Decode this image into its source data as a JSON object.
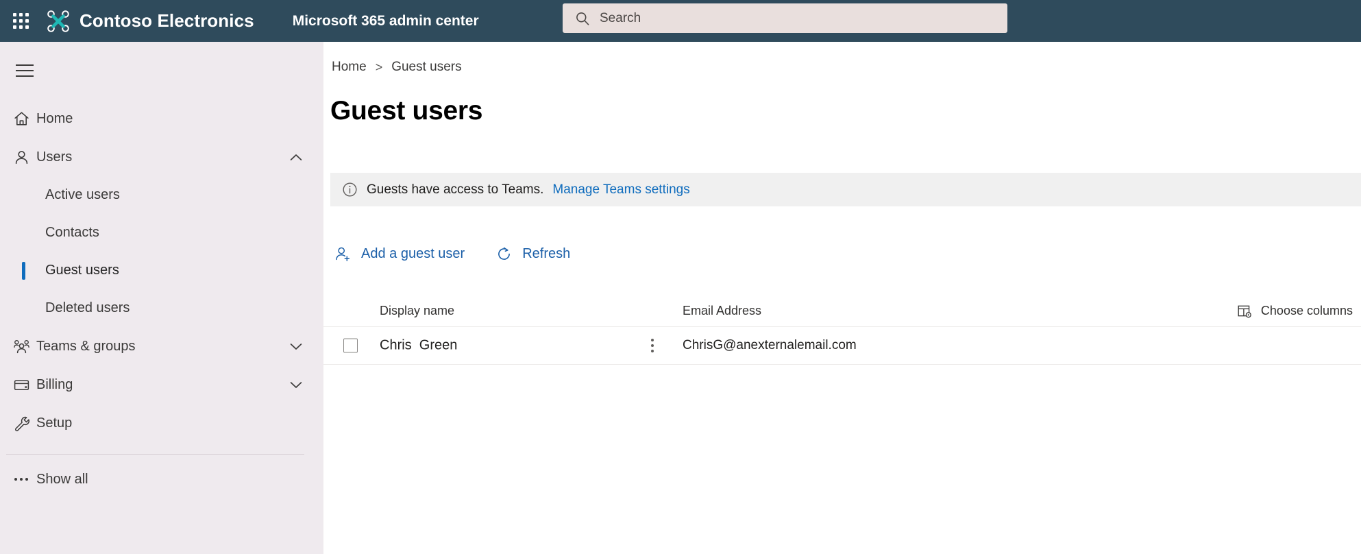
{
  "header": {
    "waffle_icon": "app-launcher-waffle-icon",
    "brand_logo_icon": "contoso-drone-logo-icon",
    "brand_name": "Contoso Electronics",
    "app_title": "Microsoft 365 admin center",
    "search": {
      "icon": "search-icon",
      "placeholder": "Search",
      "value": ""
    },
    "bg_color": "#2F4B5C",
    "search_bg_color": "#E9DFDD"
  },
  "sidebar": {
    "bg_color": "#EFEAEE",
    "hamburger_icon": "hamburger-menu-icon",
    "selected_indicator_color": "#0f6cbd",
    "items": [
      {
        "label": "Home",
        "icon": "home-icon",
        "type": "top",
        "chevron": ""
      },
      {
        "label": "Users",
        "icon": "user-icon",
        "type": "top",
        "chevron": "chevron-up-icon"
      },
      {
        "label": "Active users",
        "icon": "",
        "type": "sub",
        "selected": false
      },
      {
        "label": "Contacts",
        "icon": "",
        "type": "sub",
        "selected": false
      },
      {
        "label": "Guest users",
        "icon": "",
        "type": "sub",
        "selected": true
      },
      {
        "label": "Deleted users",
        "icon": "",
        "type": "sub",
        "selected": false
      },
      {
        "label": "Teams & groups",
        "icon": "people-group-icon",
        "type": "top",
        "chevron": "chevron-down-icon"
      },
      {
        "label": "Billing",
        "icon": "credit-card-icon",
        "type": "top",
        "chevron": "chevron-down-icon"
      },
      {
        "label": "Setup",
        "icon": "wrench-icon",
        "type": "top",
        "chevron": ""
      }
    ],
    "show_all": {
      "label": "Show all",
      "icon": "ellipsis-icon"
    }
  },
  "main": {
    "breadcrumb": {
      "home": "Home",
      "separator": ">",
      "current": "Guest users"
    },
    "page_title": "Guest users",
    "info_bar": {
      "icon": "info-circle-icon",
      "text": "Guests have access to Teams.",
      "link_text": "Manage Teams settings",
      "bg_color": "#F0F0F0",
      "link_color": "#0f6cbd"
    },
    "commands": [
      {
        "label": "Add a guest user",
        "icon": "add-user-icon"
      },
      {
        "label": "Refresh",
        "icon": "refresh-icon"
      }
    ],
    "table": {
      "columns": [
        "Display name",
        "Email Address"
      ],
      "choose_columns": {
        "label": "Choose columns",
        "icon": "choose-columns-icon"
      },
      "rows": [
        {
          "checked": false,
          "display_name": "Chris  Green",
          "email": "ChrisG@anexternalemail.com",
          "more_icon": "more-vertical-icon"
        }
      ]
    }
  }
}
